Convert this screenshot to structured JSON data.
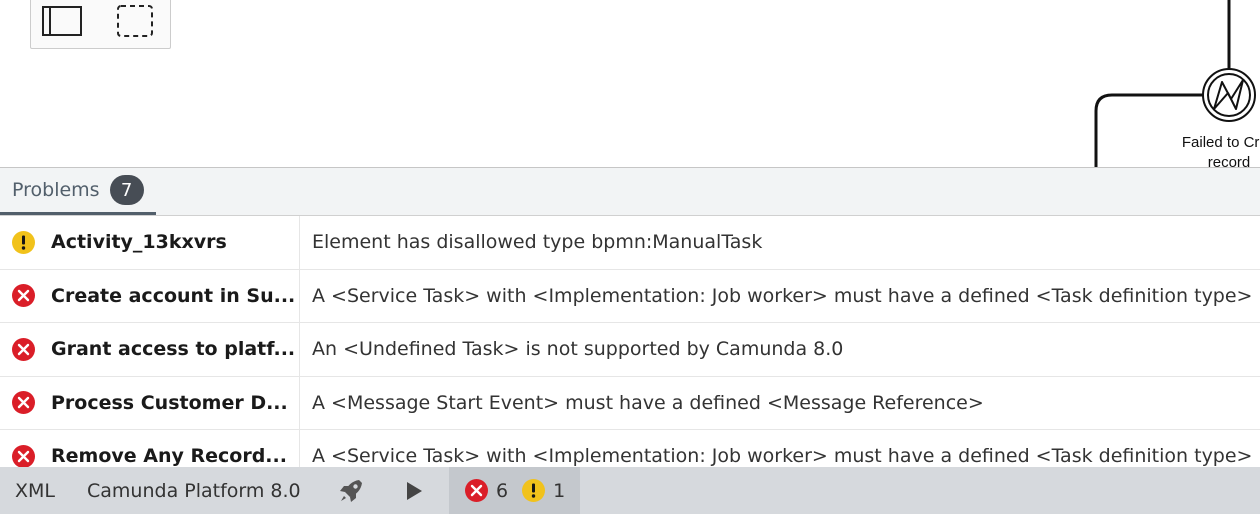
{
  "canvas": {
    "palette_tools": [
      {
        "icon": "lasso-tool-icon"
      },
      {
        "icon": "space-tool-icon"
      }
    ],
    "error_event_icon": "error-boundary-event-icon",
    "event_label_line1": "Failed to Crea",
    "event_label_line2": "record"
  },
  "panel": {
    "tab_label": "Problems",
    "tab_count": "7",
    "rows": [
      {
        "severity": "warning",
        "element": "Activity_13kxvrs",
        "message": "Element has disallowed type bpmn:ManualTask"
      },
      {
        "severity": "error",
        "element": "Create account in Su...",
        "message": "A <Service Task> with <Implementation: Job worker> must have a defined <Task definition type>"
      },
      {
        "severity": "error",
        "element": "Grant access to platf...",
        "message": "An <Undefined Task> is not supported by Camunda 8.0"
      },
      {
        "severity": "error",
        "element": "Process Customer D...",
        "message": "A <Message Start Event> must have a defined <Message Reference>"
      },
      {
        "severity": "error",
        "element": "Remove Any Record...",
        "message": "A <Service Task> with <Implementation: Job worker> must have a defined <Task definition type>"
      }
    ]
  },
  "statusbar": {
    "xml_label": "XML",
    "platform_label": "Camunda Platform 8.0",
    "deploy_icon": "rocket-icon",
    "run_icon": "play-icon",
    "error_count": "6",
    "warning_count": "1"
  },
  "colors": {
    "error": "#da1e28",
    "warning": "#f1c21b",
    "badge": "#474d55"
  }
}
